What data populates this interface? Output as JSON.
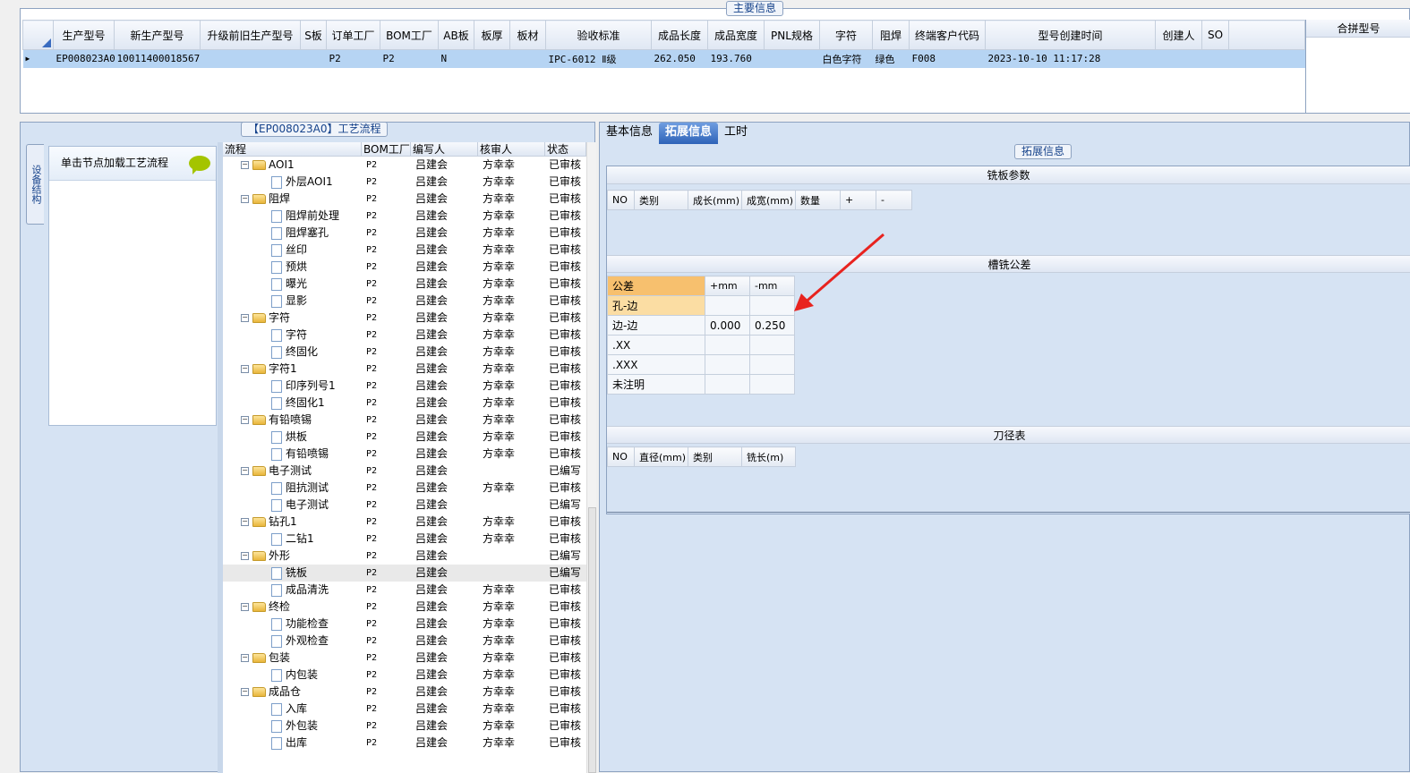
{
  "main": {
    "group_title": "主要信息",
    "columns": [
      "生产型号",
      "新生产型号",
      "升级前旧生产型号",
      "S板",
      "订单工厂",
      "BOM工厂",
      "AB板",
      "板厚",
      "板材",
      "验收标准",
      "成品长度",
      "成品宽度",
      "PNL规格",
      "字符",
      "阻焊",
      "终端客户代码",
      "型号创建时间",
      "创建人",
      "SO"
    ],
    "row": [
      "EP008023A0",
      "10011400018567",
      "",
      "",
      "P2",
      "P2",
      "N",
      "",
      "",
      "IPC-6012 Ⅱ级",
      "262.050",
      "193.760",
      "",
      "白色字符",
      "绿色",
      "F008",
      "2023-10-10 11:17:28",
      "",
      ""
    ],
    "merge_title": "合拼型号"
  },
  "left": {
    "group_title": "【EP008023A0】工艺流程",
    "side_tab": "设备结构",
    "load_hint": "单击节点加载工艺流程",
    "tree_columns": [
      "流程",
      "BOM工厂",
      "编写人",
      "核审人",
      "状态"
    ],
    "rows": [
      {
        "level": 1,
        "name": "AOI1",
        "bom": "P2",
        "writer": "吕建会",
        "auditor": "方幸幸",
        "status": "已审核"
      },
      {
        "level": 2,
        "name": "外层AOI1",
        "bom": "P2",
        "writer": "吕建会",
        "auditor": "方幸幸",
        "status": "已审核"
      },
      {
        "level": 1,
        "name": "阻焊",
        "bom": "P2",
        "writer": "吕建会",
        "auditor": "方幸幸",
        "status": "已审核"
      },
      {
        "level": 2,
        "name": "阻焊前处理",
        "bom": "P2",
        "writer": "吕建会",
        "auditor": "方幸幸",
        "status": "已审核"
      },
      {
        "level": 2,
        "name": "阻焊塞孔",
        "bom": "P2",
        "writer": "吕建会",
        "auditor": "方幸幸",
        "status": "已审核"
      },
      {
        "level": 2,
        "name": "丝印",
        "bom": "P2",
        "writer": "吕建会",
        "auditor": "方幸幸",
        "status": "已审核"
      },
      {
        "level": 2,
        "name": "预烘",
        "bom": "P2",
        "writer": "吕建会",
        "auditor": "方幸幸",
        "status": "已审核"
      },
      {
        "level": 2,
        "name": "曝光",
        "bom": "P2",
        "writer": "吕建会",
        "auditor": "方幸幸",
        "status": "已审核"
      },
      {
        "level": 2,
        "name": "显影",
        "bom": "P2",
        "writer": "吕建会",
        "auditor": "方幸幸",
        "status": "已审核"
      },
      {
        "level": 1,
        "name": "字符",
        "bom": "P2",
        "writer": "吕建会",
        "auditor": "方幸幸",
        "status": "已审核"
      },
      {
        "level": 2,
        "name": "字符",
        "bom": "P2",
        "writer": "吕建会",
        "auditor": "方幸幸",
        "status": "已审核"
      },
      {
        "level": 2,
        "name": "终固化",
        "bom": "P2",
        "writer": "吕建会",
        "auditor": "方幸幸",
        "status": "已审核"
      },
      {
        "level": 1,
        "name": "字符1",
        "bom": "P2",
        "writer": "吕建会",
        "auditor": "方幸幸",
        "status": "已审核"
      },
      {
        "level": 2,
        "name": "印序列号1",
        "bom": "P2",
        "writer": "吕建会",
        "auditor": "方幸幸",
        "status": "已审核"
      },
      {
        "level": 2,
        "name": "终固化1",
        "bom": "P2",
        "writer": "吕建会",
        "auditor": "方幸幸",
        "status": "已审核"
      },
      {
        "level": 1,
        "name": "有铅喷锡",
        "bom": "P2",
        "writer": "吕建会",
        "auditor": "方幸幸",
        "status": "已审核"
      },
      {
        "level": 2,
        "name": "烘板",
        "bom": "P2",
        "writer": "吕建会",
        "auditor": "方幸幸",
        "status": "已审核"
      },
      {
        "level": 2,
        "name": "有铅喷锡",
        "bom": "P2",
        "writer": "吕建会",
        "auditor": "方幸幸",
        "status": "已审核"
      },
      {
        "level": 1,
        "name": "电子测试",
        "bom": "P2",
        "writer": "吕建会",
        "auditor": "",
        "status": "已编写"
      },
      {
        "level": 2,
        "name": "阻抗测试",
        "bom": "P2",
        "writer": "吕建会",
        "auditor": "方幸幸",
        "status": "已审核"
      },
      {
        "level": 2,
        "name": "电子测试",
        "bom": "P2",
        "writer": "吕建会",
        "auditor": "",
        "status": "已编写"
      },
      {
        "level": 1,
        "name": "钻孔1",
        "bom": "P2",
        "writer": "吕建会",
        "auditor": "方幸幸",
        "status": "已审核"
      },
      {
        "level": 2,
        "name": "二钻1",
        "bom": "P2",
        "writer": "吕建会",
        "auditor": "方幸幸",
        "status": "已审核"
      },
      {
        "level": 1,
        "name": "外形",
        "bom": "P2",
        "writer": "吕建会",
        "auditor": "",
        "status": "已编写"
      },
      {
        "level": 2,
        "name": "铣板",
        "bom": "P2",
        "writer": "吕建会",
        "auditor": "",
        "status": "已编写",
        "selected": true
      },
      {
        "level": 2,
        "name": "成品清洗",
        "bom": "P2",
        "writer": "吕建会",
        "auditor": "方幸幸",
        "status": "已审核"
      },
      {
        "level": 1,
        "name": "终检",
        "bom": "P2",
        "writer": "吕建会",
        "auditor": "方幸幸",
        "status": "已审核"
      },
      {
        "level": 2,
        "name": "功能检查",
        "bom": "P2",
        "writer": "吕建会",
        "auditor": "方幸幸",
        "status": "已审核"
      },
      {
        "level": 2,
        "name": "外观检查",
        "bom": "P2",
        "writer": "吕建会",
        "auditor": "方幸幸",
        "status": "已审核"
      },
      {
        "level": 1,
        "name": "包装",
        "bom": "P2",
        "writer": "吕建会",
        "auditor": "方幸幸",
        "status": "已审核"
      },
      {
        "level": 2,
        "name": "内包装",
        "bom": "P2",
        "writer": "吕建会",
        "auditor": "方幸幸",
        "status": "已审核"
      },
      {
        "level": 1,
        "name": "成品仓",
        "bom": "P2",
        "writer": "吕建会",
        "auditor": "方幸幸",
        "status": "已审核"
      },
      {
        "level": 2,
        "name": "入库",
        "bom": "P2",
        "writer": "吕建会",
        "auditor": "方幸幸",
        "status": "已审核"
      },
      {
        "level": 2,
        "name": "外包装",
        "bom": "P2",
        "writer": "吕建会",
        "auditor": "方幸幸",
        "status": "已审核"
      },
      {
        "level": 2,
        "name": "出库",
        "bom": "P2",
        "writer": "吕建会",
        "auditor": "方幸幸",
        "status": "已审核"
      }
    ]
  },
  "right": {
    "tabs": [
      "基本信息",
      "拓展信息",
      "工时"
    ],
    "group_title": "拓展信息",
    "mill_params": {
      "title": "铣板参数",
      "columns": [
        "NO",
        "类别",
        "成长(mm)",
        "成宽(mm)",
        "数量",
        "+",
        "-"
      ]
    },
    "slot_tolerance": {
      "title": "槽铣公差",
      "header": [
        "公差",
        "+mm",
        "-mm"
      ],
      "rows": [
        [
          "孔-边",
          "",
          ""
        ],
        [
          "边-边",
          "0.000",
          "0.250"
        ],
        [
          ".XX",
          "",
          ""
        ],
        [
          ".XXX",
          "",
          ""
        ],
        [
          "未注明",
          "",
          ""
        ]
      ]
    },
    "cutter_table": {
      "title": "刀径表",
      "columns": [
        "NO",
        "直径(mm)",
        "类别",
        "铣长(m)"
      ]
    }
  },
  "colors": {
    "accent": "#2e63b8",
    "selection": "#b6d4f3",
    "highlight": "#f7c06e",
    "arrow": "#e8231f"
  }
}
